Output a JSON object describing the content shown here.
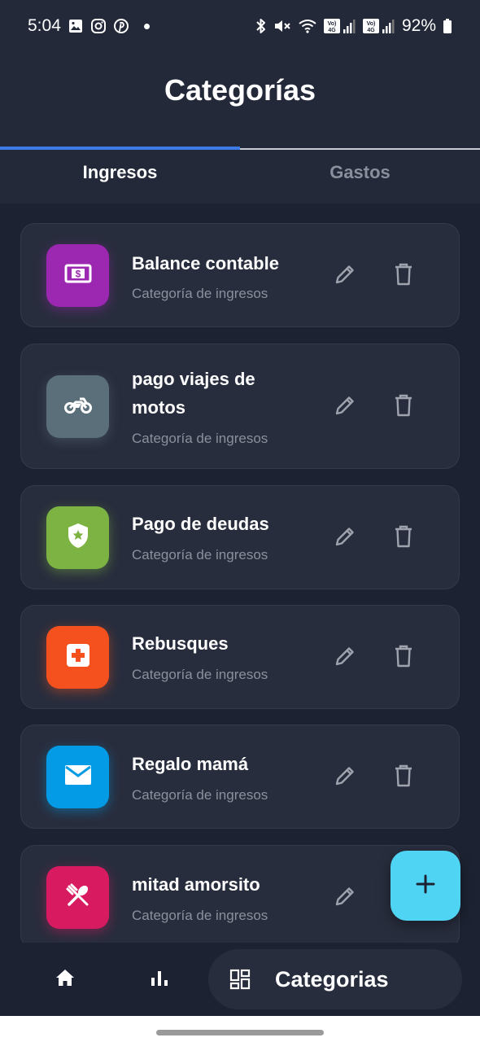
{
  "status_bar": {
    "time": "5:04",
    "battery": "92%",
    "icons": [
      "gallery-icon",
      "instagram-icon",
      "pinterest-icon",
      "notification-dot",
      "bluetooth-icon",
      "mute-icon",
      "wifi-icon",
      "volte-signal-icon",
      "volte-signal-icon",
      "battery-icon"
    ]
  },
  "header": {
    "title": "Categorías"
  },
  "tabs": [
    {
      "label": "Ingresos",
      "active": true
    },
    {
      "label": "Gastos",
      "active": false
    }
  ],
  "categories": [
    {
      "title": "Balance contable",
      "subtitle": "Categoría de ingresos",
      "icon": "money-icon",
      "color": "#9c27b0"
    },
    {
      "title": "pago viajes de motos",
      "subtitle": "Categoría de ingresos",
      "icon": "motorcycle-icon",
      "color": "#5a6f7a"
    },
    {
      "title": "Pago de deudas",
      "subtitle": "Categoría de ingresos",
      "icon": "shield-star-icon",
      "color": "#7cb342"
    },
    {
      "title": "Rebusques",
      "subtitle": "Categoría de ingresos",
      "icon": "first-aid-icon",
      "color": "#f4511e"
    },
    {
      "title": "Regalo mamá",
      "subtitle": "Categoría de ingresos",
      "icon": "mail-icon",
      "color": "#039be5"
    },
    {
      "title": "mitad amorsito",
      "subtitle": "Categoría de ingresos",
      "icon": "restaurant-icon",
      "color": "#d81b60"
    }
  ],
  "actions": {
    "edit_icon": "pencil-icon",
    "delete_icon": "trash-icon"
  },
  "fab": {
    "icon": "plus-icon",
    "color": "#4fd5f3"
  },
  "bottom_nav": {
    "items": [
      {
        "icon": "home-icon"
      },
      {
        "icon": "bar-chart-icon"
      },
      {
        "icon": "dashboard-icon",
        "label": "Categorias",
        "active": true
      }
    ]
  },
  "theme": {
    "background": "#1d2232",
    "card": "#282d3d",
    "accent": "#3d7be6"
  }
}
